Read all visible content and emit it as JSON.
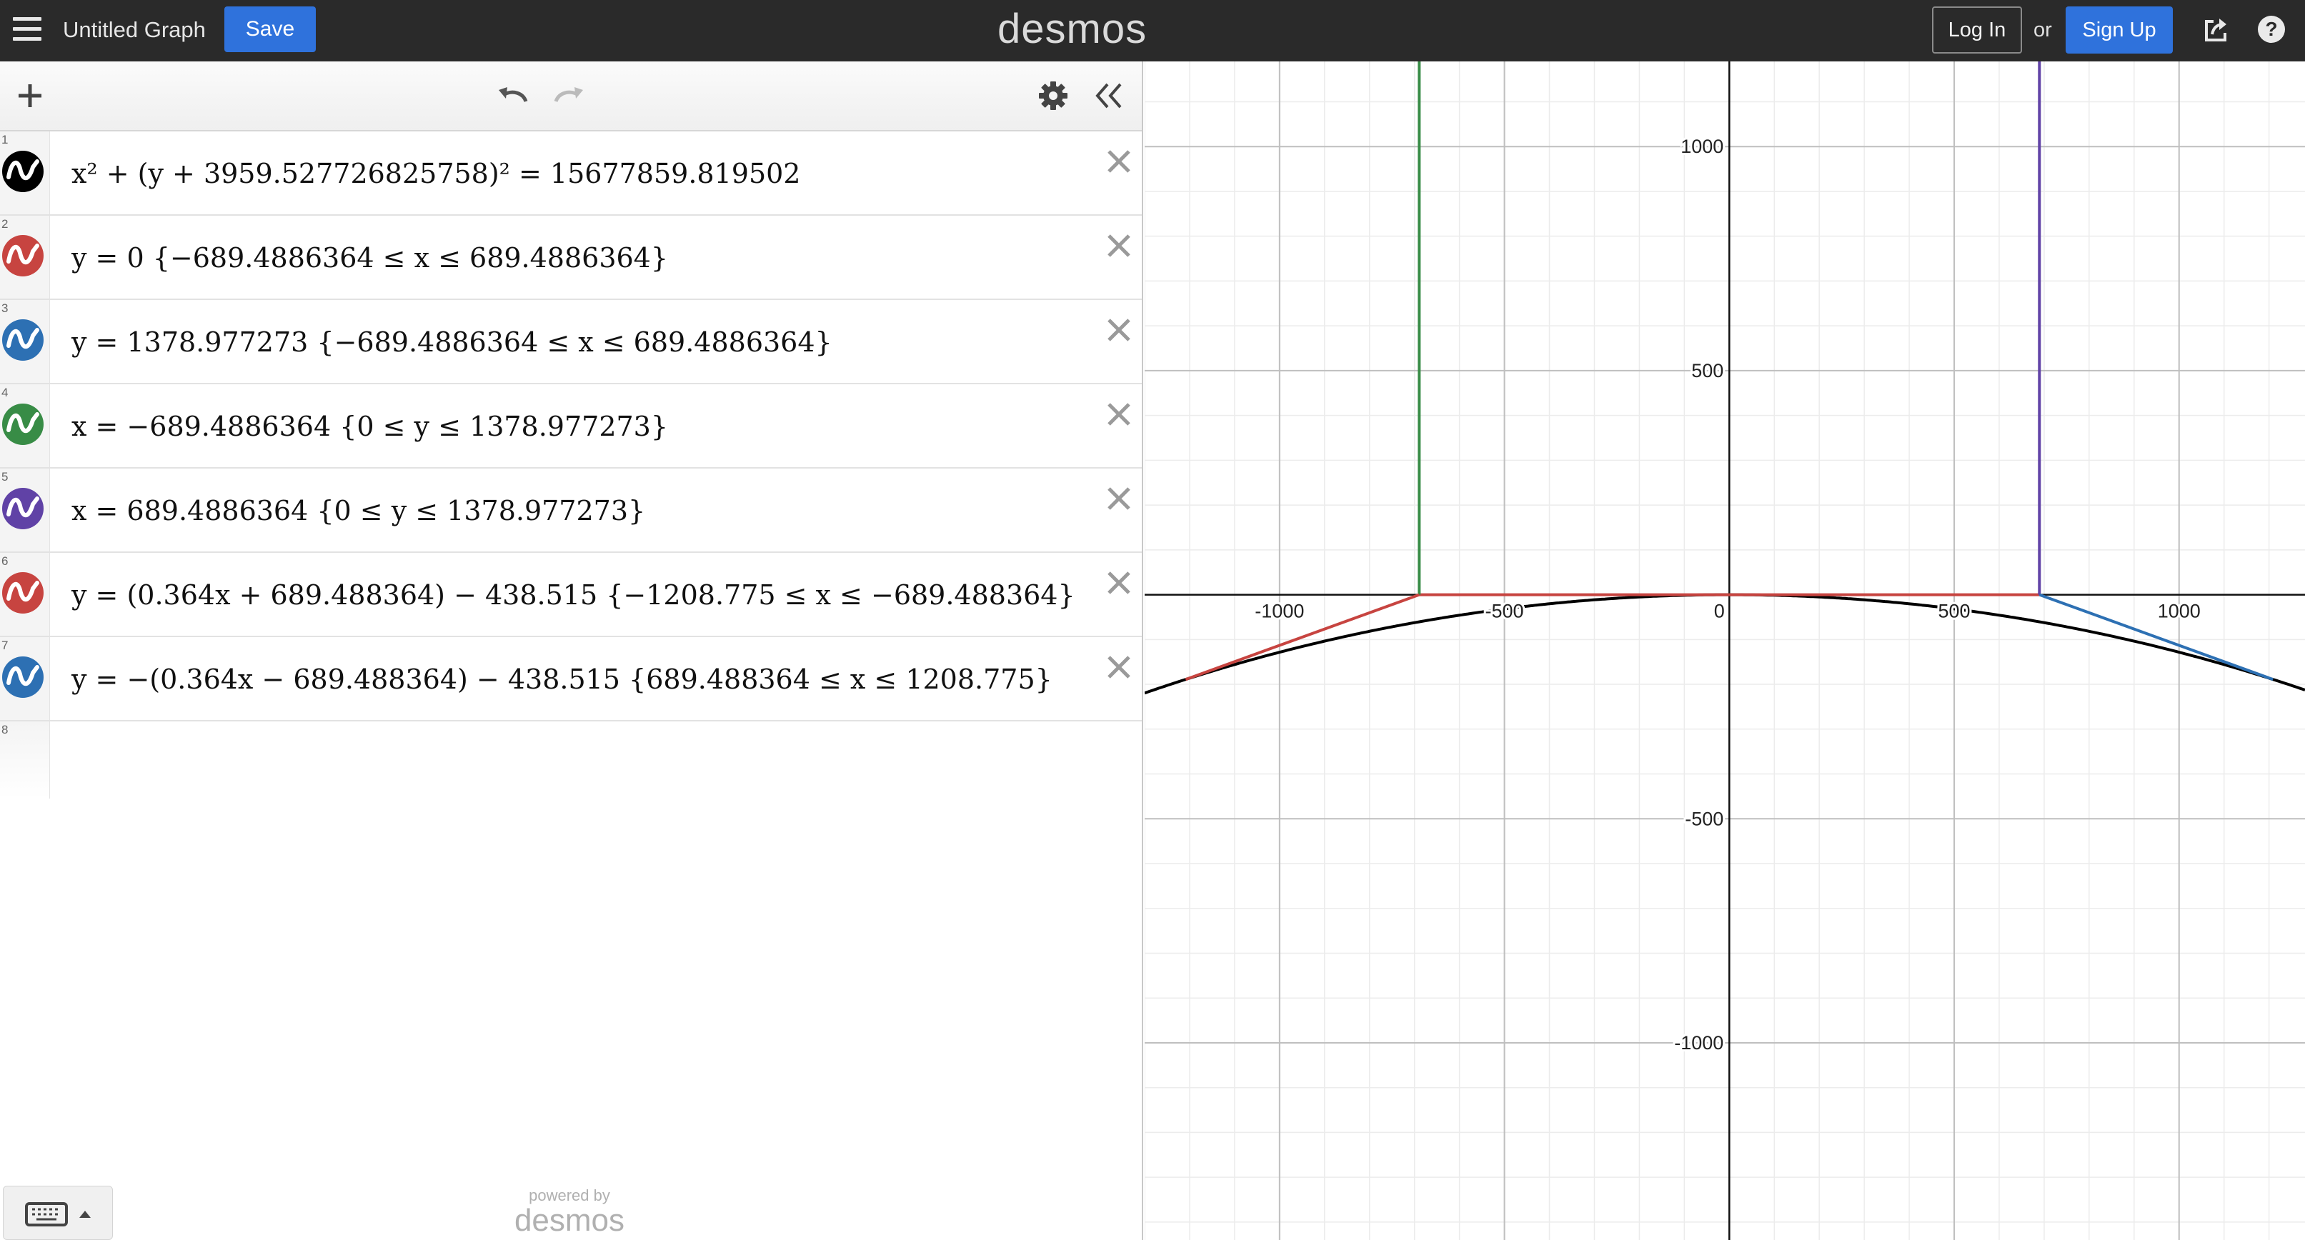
{
  "topbar": {
    "menu_icon": "hamburger-menu-icon",
    "title": "Untitled Graph",
    "save_label": "Save",
    "brand": "desmos",
    "login_label": "Log In",
    "or_text": "or",
    "signup_label": "Sign Up",
    "share_icon": "share-icon",
    "help_label": "?"
  },
  "toolbar": {
    "add_icon": "plus-icon",
    "undo_icon": "undo-icon",
    "redo_icon": "redo-icon",
    "settings_icon": "gear-icon",
    "collapse_icon": "double-chevron-left-icon"
  },
  "expressions": [
    {
      "num": "1",
      "color": "#000000",
      "latex": "x² + (y + 3959.527726825758)² = 15677859.819502"
    },
    {
      "num": "2",
      "color": "#c74440",
      "latex": "y = 0 {−689.4886364 ≤ x ≤ 689.4886364}"
    },
    {
      "num": "3",
      "color": "#2d70b3",
      "latex": "y = 1378.977273 {−689.4886364 ≤ x ≤ 689.4886364}"
    },
    {
      "num": "4",
      "color": "#388c46",
      "latex": "x = −689.4886364 {0 ≤ y ≤ 1378.977273}"
    },
    {
      "num": "5",
      "color": "#6042a6",
      "latex": "x = 689.4886364 {0 ≤ y ≤ 1378.977273}"
    },
    {
      "num": "6",
      "color": "#c74440",
      "latex": "y = (0.364x + 689.488364) − 438.515 {−1208.775 ≤ x ≤ −689.488364}"
    },
    {
      "num": "7",
      "color": "#2d70b3",
      "latex": "y = −(0.364x − 689.488364) − 438.515 {689.488364 ≤ x ≤ 1208.775}"
    },
    {
      "num": "8",
      "color": "",
      "latex": ""
    }
  ],
  "footer": {
    "keyboard_icon": "keyboard-icon",
    "keyboard_caret_icon": "caret-up-icon",
    "powered_by": "powered by",
    "powered_brand": "desmos"
  },
  "chart_data": {
    "type": "line",
    "xlim": [
      -1300,
      1280
    ],
    "ylim": [
      -1440,
      1190
    ],
    "major_step": 500,
    "minor_step": 100,
    "grid": true,
    "x_tick_labels": [
      "-1000",
      "-500",
      "0",
      "500",
      "1000"
    ],
    "y_tick_labels": [
      "1000",
      "500",
      "-500",
      "-1000"
    ],
    "series": [
      {
        "color": "#000000",
        "kind": "circle",
        "center": [
          0,
          -3959.527726825758
        ],
        "r2": 15677859.819502
      },
      {
        "color": "#c74440",
        "kind": "segment",
        "points": [
          [
            -689.4886364,
            0
          ],
          [
            689.4886364,
            0
          ]
        ]
      },
      {
        "color": "#2d70b3",
        "kind": "segment",
        "points": [
          [
            -689.4886364,
            1378.977273
          ],
          [
            689.4886364,
            1378.977273
          ]
        ]
      },
      {
        "color": "#388c46",
        "kind": "segment",
        "points": [
          [
            -689.4886364,
            0
          ],
          [
            -689.4886364,
            1378.977273
          ]
        ]
      },
      {
        "color": "#6042a6",
        "kind": "segment",
        "points": [
          [
            689.4886364,
            0
          ],
          [
            689.4886364,
            1378.977273
          ]
        ]
      },
      {
        "color": "#c74440",
        "kind": "linear",
        "slope": 0.364,
        "intercept": 250.973364,
        "domain": [
          -1208.775,
          -689.488364
        ]
      },
      {
        "color": "#2d70b3",
        "kind": "linear",
        "slope": -0.364,
        "intercept": 250.973364,
        "domain": [
          689.488364,
          1208.775
        ]
      }
    ]
  }
}
